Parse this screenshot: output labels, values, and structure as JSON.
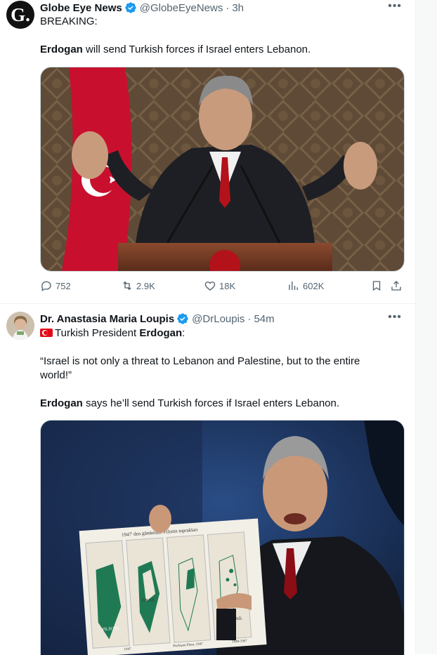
{
  "tweets": [
    {
      "author_name": "Globe Eye News",
      "handle": "@GlobeEyeNews",
      "time": "3h",
      "avatar_letter": "G.",
      "line1": "BREAKING:",
      "line2_bold": "Erdogan",
      "line2_rest": " will send Turkish forces if Israel enters Lebanon.",
      "media_alt": "Photo of Erdogan speaking at a podium with Turkish flag",
      "replies": "752",
      "reposts": "2.9K",
      "likes": "18K",
      "views": "602K"
    },
    {
      "author_name": "Dr. Anastasia Maria Loupis",
      "handle": "@DrLoupis",
      "time": "54m",
      "line1_prefix": "Turkish President ",
      "line1_bold": "Erdogan",
      "line1_suffix": ":",
      "quote": "“Israel is not only a threat to Lebanon and Palestine, but to the entire world!”",
      "line3_bold": "Erdogan",
      "line3_rest": " says he’ll send Turkish forces if Israel enters Lebanon.",
      "media_alt": "Photo of Erdogan holding up a map at the UN",
      "map_title": "1947' den günümüze Filistin toprakları",
      "map_labels": [
        "FİLİSTİN",
        "İSRAİL",
        "Paylaşım Planı, 1947",
        "İSRAİL",
        "1947",
        "1949-1967"
      ]
    }
  ],
  "colors": {
    "text": "#0f1419",
    "secondary": "#536471",
    "verified": "#1d9bf0",
    "border": "#cfd9de"
  }
}
